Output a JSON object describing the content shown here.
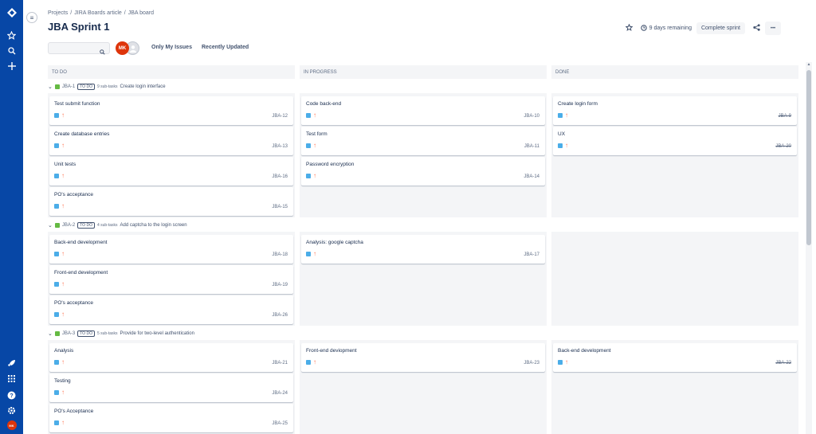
{
  "breadcrumb": [
    "Projects",
    "JIRA Boards article",
    "JBA board"
  ],
  "page_title": "JBA Sprint 1",
  "header": {
    "days_remaining": "9 days remaining",
    "complete_sprint": "Complete sprint",
    "more": "•••"
  },
  "filters": {
    "search_placeholder": "",
    "avatar_initials": "MK",
    "only_my_issues": "Only My Issues",
    "recently_updated": "Recently Updated"
  },
  "columns": [
    "TO DO",
    "IN PROGRESS",
    "DONE"
  ],
  "swimlanes": [
    {
      "key": "JBA-1",
      "status": "TO DO",
      "subtasks": "9 sub-tasks",
      "summary": "Create login interface",
      "todo": [
        {
          "title": "Test submit function",
          "key": "JBA-12"
        },
        {
          "title": "Create database entries",
          "key": "JBA-13"
        },
        {
          "title": "Unit tests",
          "key": "JBA-16"
        },
        {
          "title": "PO's acceptance",
          "key": "JBA-15"
        }
      ],
      "inprogress": [
        {
          "title": "Code back-end",
          "key": "JBA-10"
        },
        {
          "title": "Test form",
          "key": "JBA-11"
        },
        {
          "title": "Password encryption",
          "key": "JBA-14"
        }
      ],
      "done": [
        {
          "title": "Create login form",
          "key": "JBA-9"
        },
        {
          "title": "UX",
          "key": "JBA-20"
        }
      ]
    },
    {
      "key": "JBA-2",
      "status": "TO DO",
      "subtasks": "4 sub-tasks",
      "summary": "Add captcha to the login screen",
      "todo": [
        {
          "title": "Back-end development",
          "key": "JBA-18"
        },
        {
          "title": "Front-end development",
          "key": "JBA-19"
        },
        {
          "title": "PO's acceptance",
          "key": "JBA-26"
        }
      ],
      "inprogress": [
        {
          "title": "Analysis: google captcha",
          "key": "JBA-17"
        }
      ],
      "done": []
    },
    {
      "key": "JBA-3",
      "status": "TO DO",
      "subtasks": "5 sub-tasks",
      "summary": "Provide for two-level authentication",
      "todo": [
        {
          "title": "Analysis",
          "key": "JBA-21"
        },
        {
          "title": "Testing",
          "key": "JBA-24"
        },
        {
          "title": "PO's Acceptance",
          "key": "JBA-25"
        }
      ],
      "inprogress": [
        {
          "title": "Front-end deviopment",
          "key": "JBA-23"
        }
      ],
      "done": [
        {
          "title": "Back-end development",
          "key": "JBA-22"
        }
      ]
    }
  ],
  "icons": {
    "type": "subtask-icon",
    "priority": "priority-arrow-up-icon"
  },
  "colors": {
    "nav": "#0747a6",
    "story": "#65ba43",
    "subtask": "#4bade8",
    "priority": "#ff7452",
    "avatar": "#de350b"
  }
}
